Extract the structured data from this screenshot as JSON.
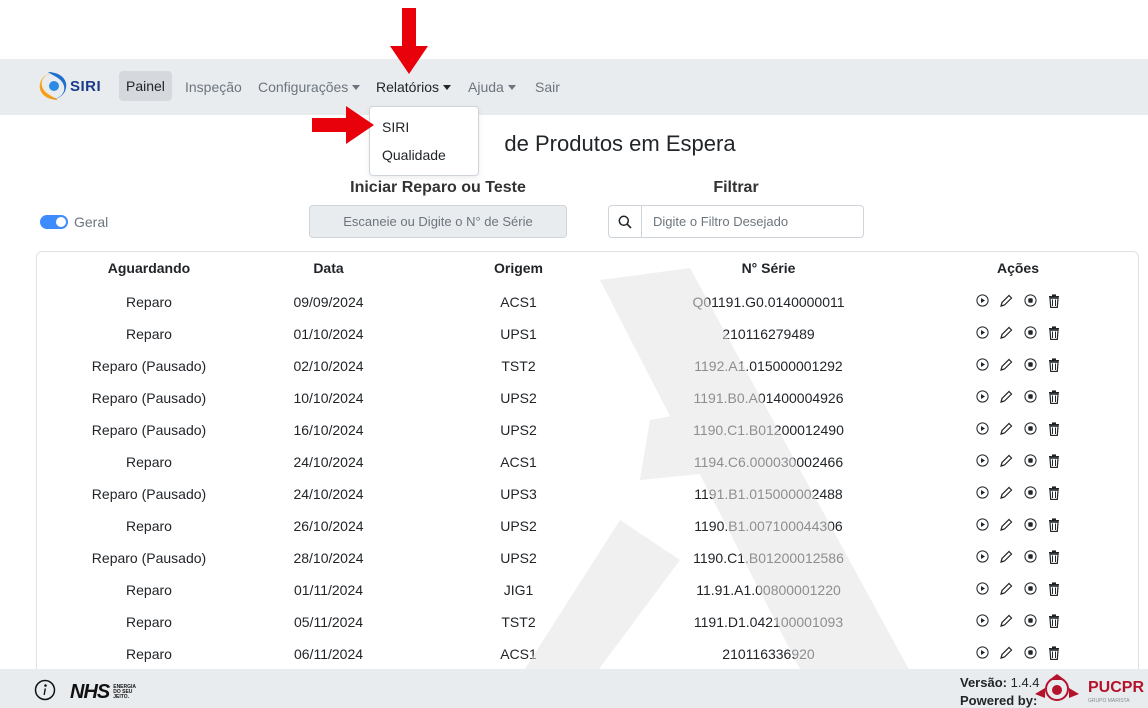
{
  "navbar": {
    "brand": "SIRI",
    "items": [
      {
        "label": "Painel"
      },
      {
        "label": "Inspeção"
      },
      {
        "label": "Configurações"
      },
      {
        "label": "Relatórios"
      },
      {
        "label": "Ajuda"
      },
      {
        "label": "Sair"
      }
    ]
  },
  "dropdown": {
    "items": [
      {
        "label": "SIRI"
      },
      {
        "label": "Qualidade"
      }
    ]
  },
  "page_title": "de Produtos em Espera",
  "scan": {
    "label": "Iniciar Reparo ou Teste",
    "placeholder": "Escaneie ou Digite o N° de Série"
  },
  "filter": {
    "label": "Filtrar",
    "placeholder": "Digite o Filtro Desejado"
  },
  "toggle": {
    "label": "Geral",
    "checked": true
  },
  "table": {
    "headers": [
      "Aguardando",
      "Data",
      "Origem",
      "N° Série",
      "Ações"
    ],
    "rows": [
      [
        "Reparo",
        "09/09/2024",
        "ACS1",
        "Q01191.G0.0140000011"
      ],
      [
        "Reparo",
        "01/10/2024",
        "UPS1",
        "210116279489"
      ],
      [
        "Reparo (Pausado)",
        "02/10/2024",
        "TST2",
        "1192.A1.015000001292"
      ],
      [
        "Reparo (Pausado)",
        "10/10/2024",
        "UPS2",
        "1191.B0.A01400004926"
      ],
      [
        "Reparo (Pausado)",
        "16/10/2024",
        "UPS2",
        "1190.C1.B01200012490"
      ],
      [
        "Reparo",
        "24/10/2024",
        "ACS1",
        "1194.C6.000030002466"
      ],
      [
        "Reparo (Pausado)",
        "24/10/2024",
        "UPS3",
        "1191.B1.015000002488"
      ],
      [
        "Reparo",
        "26/10/2024",
        "UPS2",
        "1190.B1.007100044306"
      ],
      [
        "Reparo (Pausado)",
        "28/10/2024",
        "UPS2",
        "1190.C1.B01200012586"
      ],
      [
        "Reparo",
        "01/11/2024",
        "JIG1",
        "11.91.A1.00800001220"
      ],
      [
        "Reparo",
        "05/11/2024",
        "TST2",
        "1191.D1.042100001093"
      ],
      [
        "Reparo",
        "06/11/2024",
        "ACS1",
        "210116336920"
      ]
    ],
    "row_actions": [
      "play-icon",
      "pencil-icon",
      "stop-icon",
      "trash-icon"
    ]
  },
  "footer": {
    "nhs_logo": "NHS",
    "nhs_tagline": "ENERGIA DO SEU JEITO.",
    "version_label": "Versão:",
    "version": "1.4.4",
    "powered_by": "Powered by:",
    "partner": "PUCPR",
    "partner_sub": "GRUPO MARISTA"
  },
  "colors": {
    "navbar_bg": "#e9ecef",
    "accent": "#3d8bfd",
    "annotation_arrow": "#e8000b",
    "partner": "#b5122b"
  }
}
